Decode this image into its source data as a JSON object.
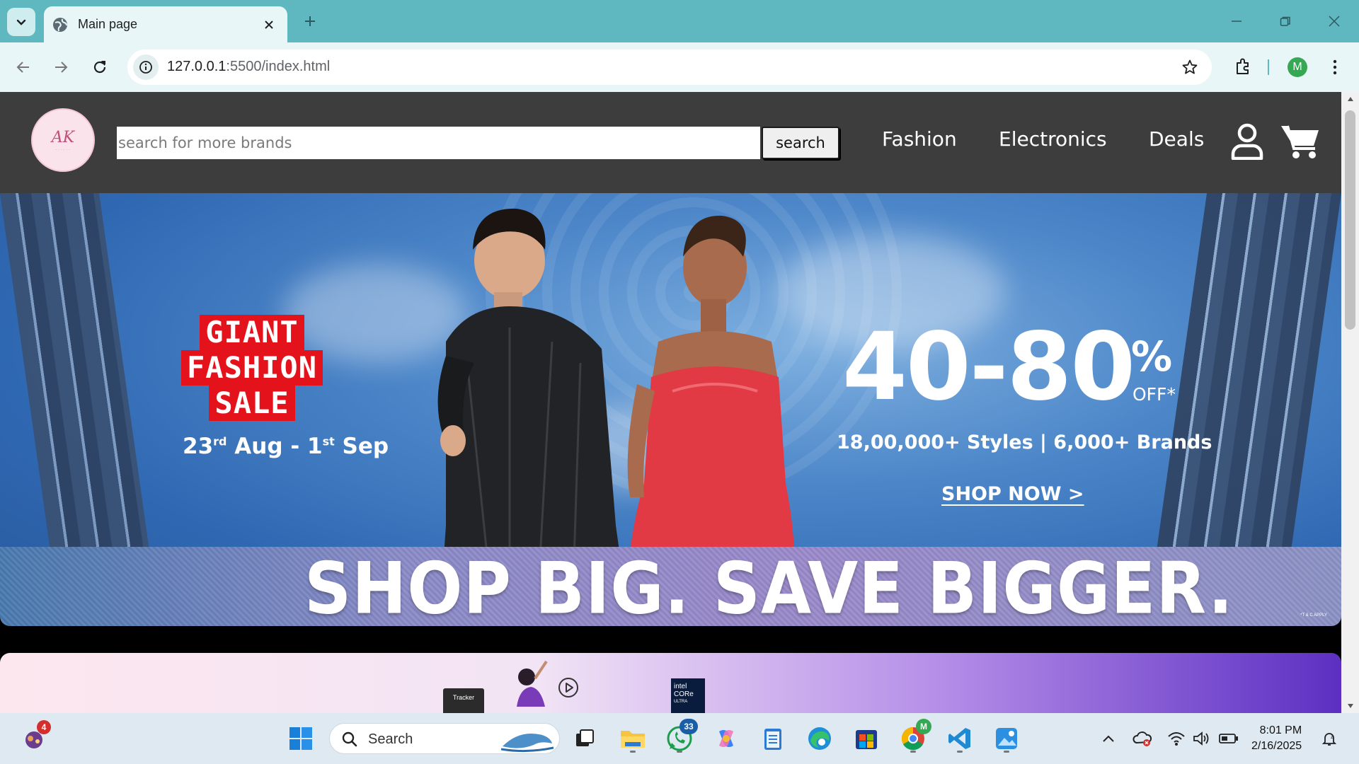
{
  "browser": {
    "tab": {
      "title": "Main page"
    },
    "address": {
      "host": "127.0.0.1",
      "path": ":5500/index.html"
    },
    "profile_initial": "M"
  },
  "site": {
    "search": {
      "placeholder": "search for more brands",
      "button_label": "search"
    },
    "nav": [
      "Fashion",
      "Electronics",
      "Deals"
    ],
    "logo": {
      "monogram": "AK"
    }
  },
  "hero": {
    "sale_lines": [
      "GIANT",
      "FASHION",
      "SALE"
    ],
    "dates": {
      "d1": "23",
      "s1": "rd",
      "m1": " Aug - 1",
      "s2": "st",
      "m2": " Sep"
    },
    "discount": "40-80",
    "pct": "%",
    "off": "OFF*",
    "styles": "18,00,000+ Styles | 6,000+ Brands",
    "cta": "SHOP NOW >",
    "tagline": "SHOP BIG. SAVE BIGGER.",
    "tc": "*T & C APPLY"
  },
  "banner2": {
    "tracker": "Tracker",
    "intel_line1": "intel",
    "intel_line2": "CORe",
    "intel_line3": "ULTRA"
  },
  "taskbar": {
    "search_label": "Search",
    "widgets_badge": "4",
    "whatsapp_badge": "33",
    "chrome_badge": "M",
    "time": "8:01 PM",
    "date": "2/16/2025"
  },
  "colors": {
    "tabstrip": "#5fb7bf",
    "toolbar": "#e8f6f7",
    "site_header": "#3d3d3d",
    "sale_red": "#e4121b"
  },
  "icons": [
    "tab-search-icon",
    "globe-icon",
    "close-icon",
    "plus-icon",
    "minimize-icon",
    "restore-icon",
    "back-icon",
    "forward-icon",
    "reload-icon",
    "info-icon",
    "star-icon",
    "extensions-icon",
    "kebab-icon",
    "user-icon",
    "cart-icon",
    "windows-icon"
  ]
}
